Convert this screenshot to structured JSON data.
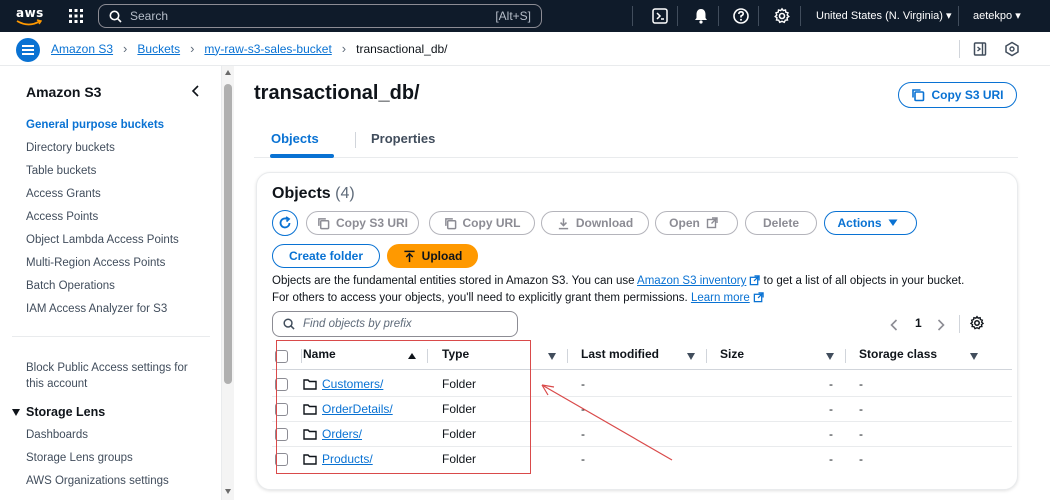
{
  "topbar": {
    "logo_text": "aws",
    "search_placeholder": "Search",
    "search_shortcut": "[Alt+S]",
    "region": "United States (N. Virginia) ▾",
    "user": "aetekpo ▾"
  },
  "breadcrumbs": [
    {
      "label": "Amazon S3"
    },
    {
      "label": "Buckets"
    },
    {
      "label": "my-raw-s3-sales-bucket"
    },
    {
      "label": "transactional_db/"
    }
  ],
  "sidebar": {
    "title": "Amazon S3",
    "items": [
      {
        "label": "General purpose buckets",
        "active": true
      },
      {
        "label": "Directory buckets"
      },
      {
        "label": "Table buckets"
      },
      {
        "label": "Access Grants"
      },
      {
        "label": "Access Points"
      },
      {
        "label": "Object Lambda Access Points"
      },
      {
        "label": "Multi-Region Access Points"
      },
      {
        "label": "Batch Operations"
      },
      {
        "label": "IAM Access Analyzer for S3"
      }
    ],
    "block_public_line1": "Block Public Access settings for",
    "block_public_line2": "this account",
    "storage_lens": {
      "title": "Storage Lens",
      "items": [
        {
          "label": "Dashboards"
        },
        {
          "label": "Storage Lens groups"
        },
        {
          "label": "AWS Organizations settings"
        }
      ]
    }
  },
  "page": {
    "title": "transactional_db/",
    "copy_uri_label": "Copy S3 URI",
    "tabs": [
      {
        "label": "Objects",
        "active": true
      },
      {
        "label": "Properties"
      }
    ]
  },
  "objects_panel": {
    "title": "Objects",
    "count": "(4)",
    "actions": {
      "copy_s3_uri": "Copy S3 URI",
      "copy_url": "Copy URL",
      "download": "Download",
      "open": "Open",
      "delete": "Delete",
      "actions": "Actions",
      "create_folder": "Create folder",
      "upload": "Upload"
    },
    "info": {
      "line1_pre": "Objects are the fundamental entities stored in Amazon S3. You can use ",
      "line1_link": "Amazon S3 inventory",
      "line1_post": " to get a list of all objects in your bucket.",
      "line2_pre": "For others to access your objects, you'll need to explicitly grant them permissions. ",
      "line2_link": "Learn more"
    },
    "find_placeholder": "Find objects by prefix",
    "page_number": "1",
    "columns": [
      "Name",
      "Type",
      "Last modified",
      "Size",
      "Storage class"
    ],
    "rows": [
      {
        "name": "Customers/",
        "type": "Folder",
        "last_modified": "-",
        "size": "-",
        "storage_class": "-"
      },
      {
        "name": "OrderDetails/",
        "type": "Folder",
        "last_modified": "-",
        "size": "-",
        "storage_class": "-"
      },
      {
        "name": "Orders/",
        "type": "Folder",
        "last_modified": "-",
        "size": "-",
        "storage_class": "-"
      },
      {
        "name": "Products/",
        "type": "Folder",
        "last_modified": "-",
        "size": "-",
        "storage_class": "-"
      }
    ]
  },
  "colors": {
    "accent": "#0972d3",
    "upload": "#ff9900",
    "topbar": "#0f1b2a",
    "annotation": "#d94a4a"
  }
}
